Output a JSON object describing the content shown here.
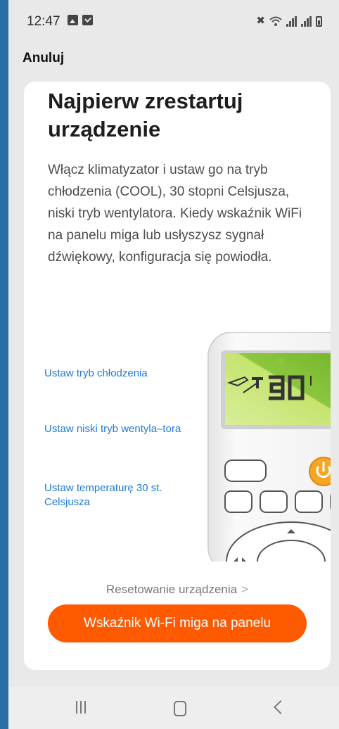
{
  "status_bar": {
    "time": "12:47",
    "left_icons": [
      "image-icon",
      "check-icon"
    ],
    "right_icons": [
      "mute-icon",
      "wifi-icon",
      "signal-icon",
      "signal-icon",
      "battery-icon"
    ]
  },
  "header": {
    "cancel_label": "Anuluj"
  },
  "card": {
    "title": "Najpierw zrestartuj urządzenie",
    "description": "Włącz klimatyzator i ustaw go na tryb chłodzenia (COOL), 30 stopni Celsjusza, niski tryb wentylatora. Kiedy wskaźnik WiFi na panelu miga lub usłyszysz sygnał dźwiękowy, konfiguracja się powiodła.",
    "steps": [
      "Ustaw tryb chłodzenia",
      "Ustaw niski tryb wentyla–tora",
      "Ustaw temperaturę 30 st. Celsjusza"
    ],
    "remote_display": "30",
    "reset_link_label": "Resetowanie urządzenia",
    "reset_link_chevron": ">",
    "primary_button_label": "Wskaźnik Wi-Fi miga na panelu"
  },
  "nav_bar": {
    "buttons": [
      "recent-apps",
      "home",
      "back"
    ]
  },
  "colors": {
    "accent": "#ff5a00",
    "link": "#1f7ad6",
    "background": "#e9e9e9",
    "card": "#ffffff",
    "frame": "#2a6ea6"
  }
}
